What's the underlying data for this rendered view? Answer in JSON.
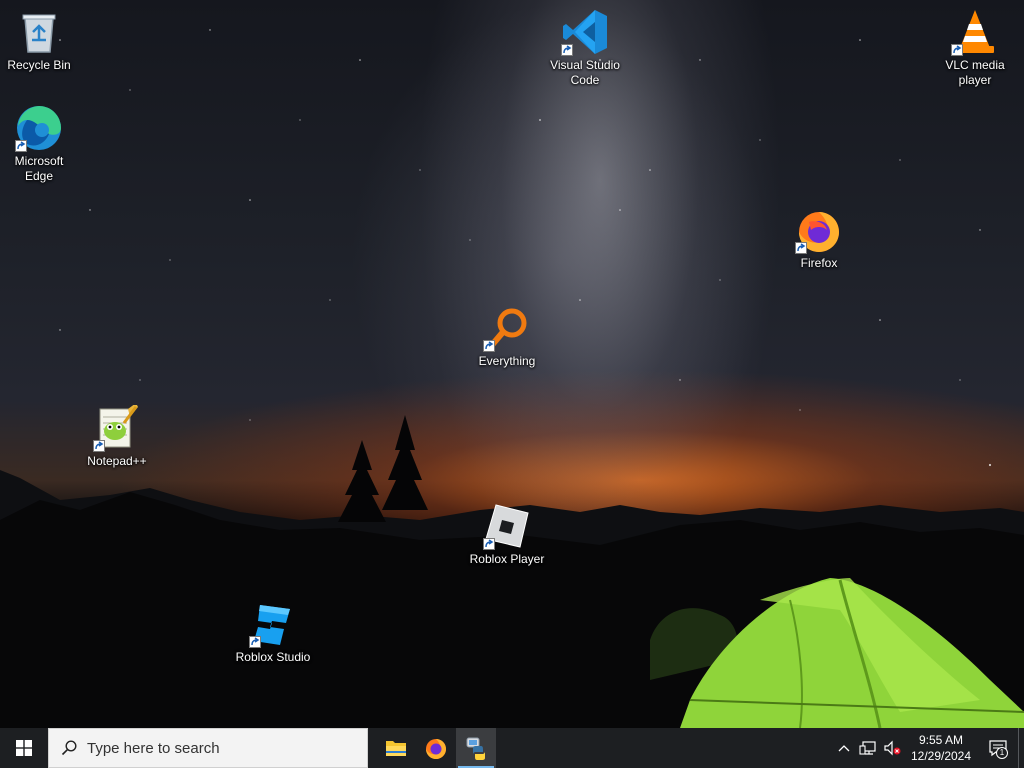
{
  "desktop": {
    "icons": [
      {
        "id": "recycle-bin",
        "label": "Recycle Bin",
        "icon": "recycle-bin-icon",
        "shortcut": false
      },
      {
        "id": "microsoft-edge",
        "label": "Microsoft\nEdge",
        "icon": "edge-icon",
        "shortcut": true
      },
      {
        "id": "notepad-plus-plus",
        "label": "Notepad++",
        "icon": "notepad-plus-plus-icon",
        "shortcut": true
      },
      {
        "id": "roblox-studio",
        "label": "Roblox Studio",
        "icon": "roblox-studio-icon",
        "shortcut": true
      },
      {
        "id": "everything",
        "label": "Everything",
        "icon": "everything-search-icon",
        "shortcut": true
      },
      {
        "id": "roblox-player",
        "label": "Roblox Player",
        "icon": "roblox-player-icon",
        "shortcut": true
      },
      {
        "id": "visual-studio-code",
        "label": "Visual Studio\nCode",
        "icon": "vscode-icon",
        "shortcut": true
      },
      {
        "id": "firefox",
        "label": "Firefox",
        "icon": "firefox-icon",
        "shortcut": true
      },
      {
        "id": "vlc",
        "label": "VLC media\nplayer",
        "icon": "vlc-icon",
        "shortcut": true
      }
    ]
  },
  "taskbar": {
    "start": {
      "icon": "windows-logo-icon"
    },
    "search": {
      "placeholder": "Type here to search",
      "icon": "search-icon"
    },
    "pinned": [
      {
        "id": "file-explorer",
        "icon": "folder-icon",
        "active": false
      },
      {
        "id": "firefox",
        "icon": "firefox-icon",
        "active": false
      },
      {
        "id": "python-app",
        "icon": "python-icon",
        "active": true
      }
    ],
    "tray": {
      "overflow_icon": "chevron-up-icon",
      "network_icon": "network-icon",
      "volume_icon": "volume-muted-icon",
      "time": "9:55 AM",
      "date": "12/29/2024",
      "notification_icon": "action-center-icon",
      "notification_count": "1"
    }
  },
  "colors": {
    "taskbar_bg": "#1d1f22",
    "active_underline": "#76b9ed",
    "tent": "#8fd43a",
    "horizon_glow": "#e66e1e"
  }
}
